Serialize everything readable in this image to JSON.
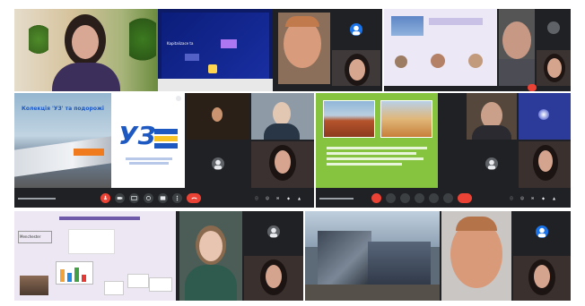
{
  "theme": {
    "meet_bg": "#202124",
    "end_call_red": "#ea4335",
    "uz_blue": "#1e59c2",
    "uz_yellow": "#f7c325",
    "green_slide": "#86c440",
    "frame_border": "#2d2d2d"
  },
  "screen1": {
    "slide_heading": "Kapitalizace ta",
    "slide_btn": "",
    "tile_labels": [
      "",
      "",
      ""
    ]
  },
  "screen2": {
    "slide_title": "Колекція 'УЗ' та подорожі",
    "logo_text": "УЗ",
    "logo_caption": "",
    "presenter_label": "",
    "meeting_code": "",
    "tile_labels": [
      "",
      "",
      ""
    ]
  },
  "screen3": {
    "slide_title": "",
    "tile_labels": [
      "",
      "",
      ""
    ]
  },
  "screen4": {
    "slide_title": "",
    "slide_panel": "Menchester",
    "tile_labels": [
      "",
      "",
      ""
    ]
  },
  "icons": [
    "microphone-icon",
    "camera-icon",
    "captions-icon",
    "present-icon",
    "reaction-icon",
    "more-options-icon",
    "end-call-icon",
    "info-icon",
    "people-icon",
    "chat-icon",
    "activities-icon",
    "lock-icon"
  ]
}
